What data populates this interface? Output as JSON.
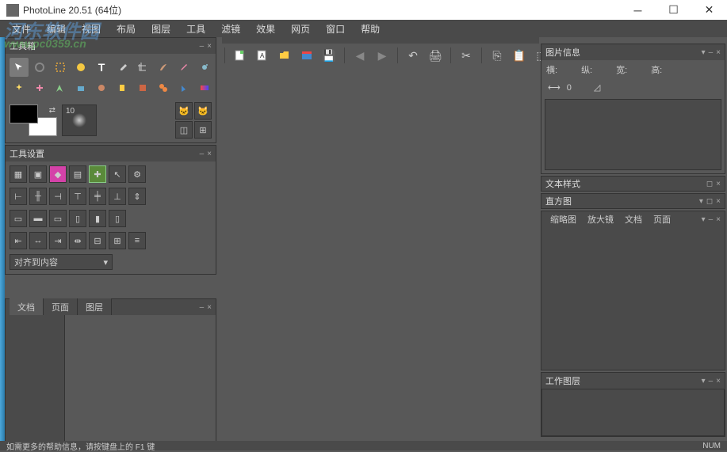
{
  "title": "PhotoLine 20.51 (64位)",
  "watermark": "河东软件园",
  "watermark_url": "www.pc0359.cn",
  "menu": [
    "文件",
    "编辑",
    "视图",
    "布局",
    "图层",
    "工具",
    "滤镜",
    "效果",
    "网页",
    "窗口",
    "帮助"
  ],
  "panels": {
    "toolbox": {
      "title": "工具箱",
      "brush_size": "10"
    },
    "tool_settings": {
      "title": "工具设置",
      "align_mode": "对齐到内容"
    },
    "docs": {
      "tabs": [
        "文档",
        "页面",
        "图层"
      ]
    },
    "image_info": {
      "title": "图片信息",
      "labels": {
        "h": "横:",
        "v": "纵:",
        "w": "宽:",
        "h2": "高:"
      },
      "width_val": "0"
    },
    "text_style": "文本样式",
    "histogram": "直方图",
    "thumbs": {
      "tabs": [
        "缩略图",
        "放大镜",
        "文档",
        "页面"
      ]
    },
    "work_layer": "工作图层"
  },
  "status": {
    "help": "如需更多的帮助信息，请按键盘上的 F1 键",
    "num": "NUM"
  }
}
